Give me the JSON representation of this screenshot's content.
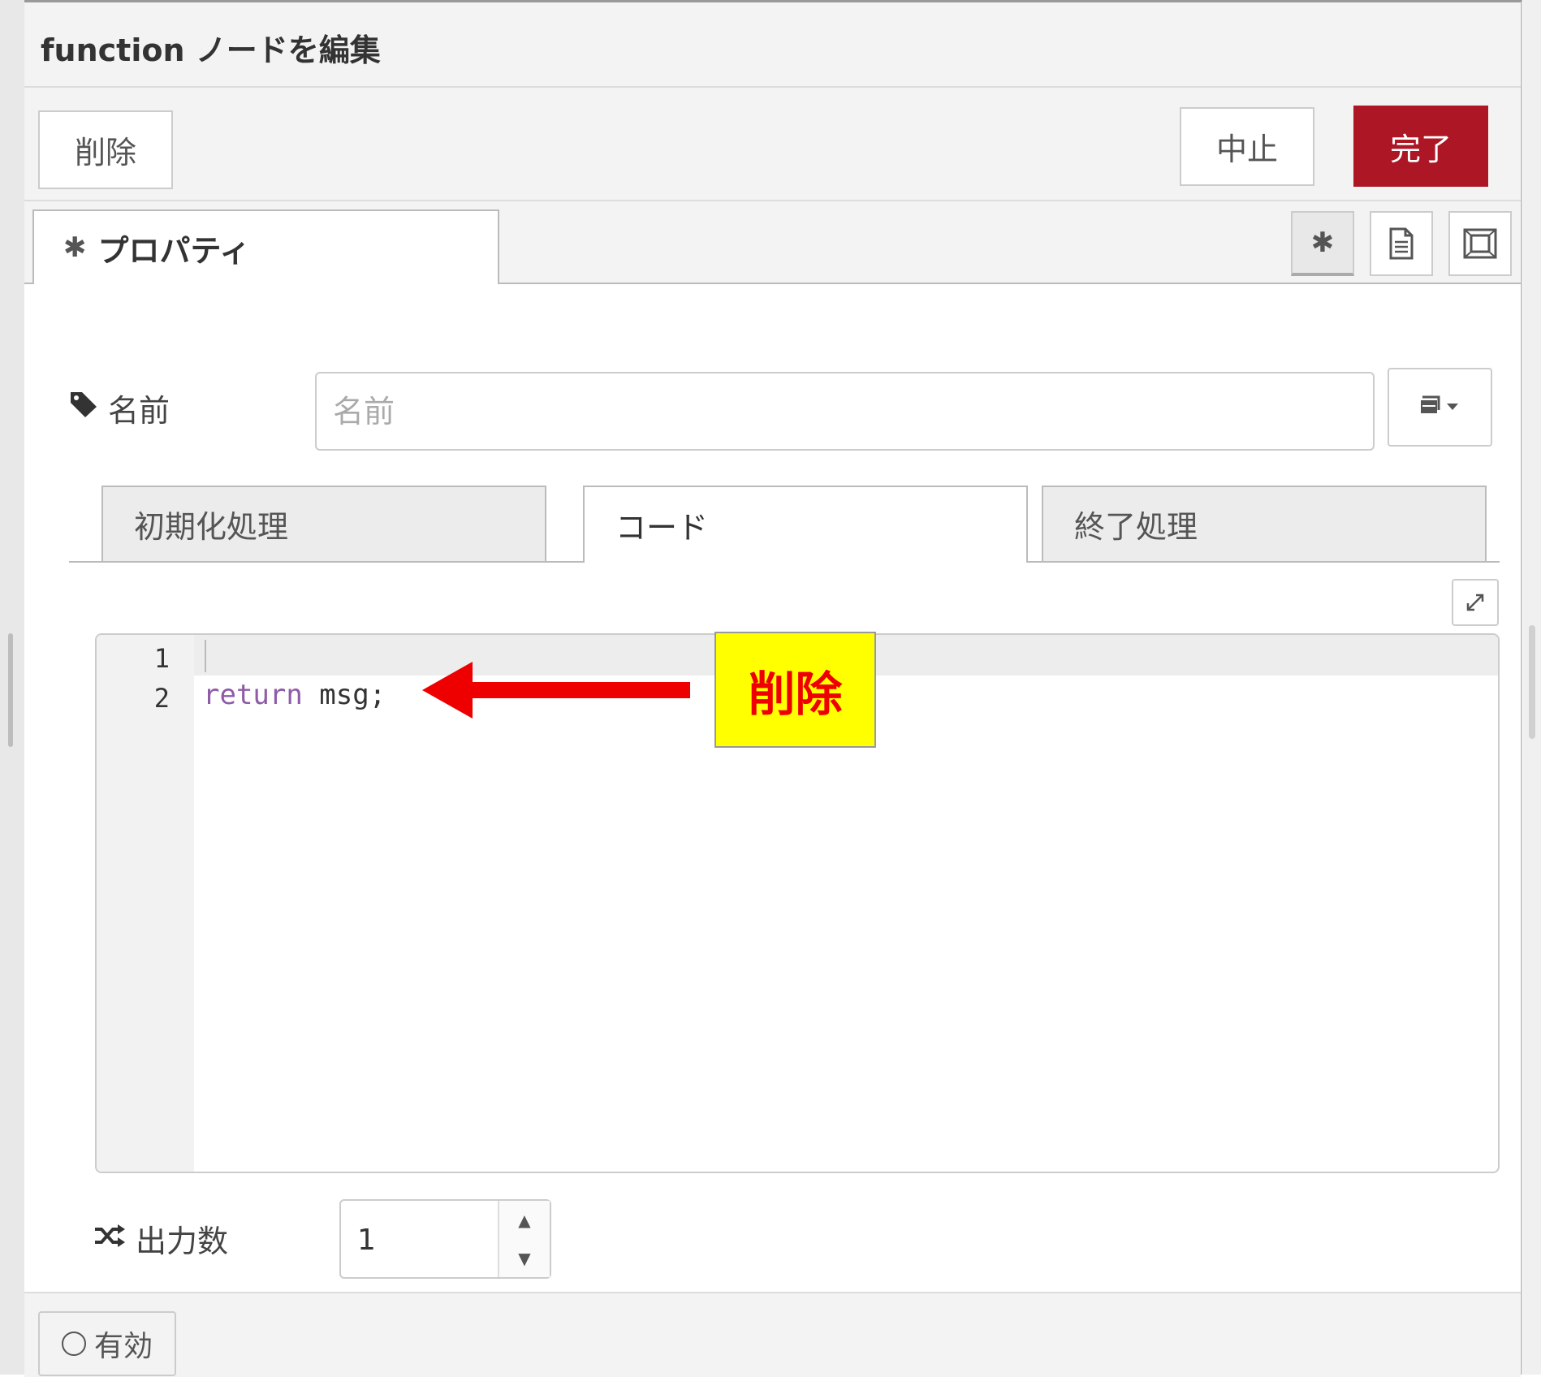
{
  "header": {
    "title": "function ノードを編集"
  },
  "toolbar": {
    "delete_label": "削除",
    "cancel_label": "中止",
    "done_label": "完了"
  },
  "tabs": {
    "properties_label": "プロパティ",
    "icons": [
      "gear-icon",
      "document-icon",
      "frame-icon"
    ]
  },
  "form": {
    "name_label": "名前",
    "name_placeholder": "名前",
    "name_value": "",
    "icon_select": "book-icon",
    "subtabs": [
      "初期化処理",
      "コード",
      "終了処理"
    ],
    "active_subtab": "コード",
    "outputs_label": "出力数",
    "outputs_value": "1"
  },
  "editor": {
    "line_numbers": [
      "1",
      "2"
    ],
    "code_lines": [
      "",
      "return msg;"
    ],
    "keyword": "return",
    "rest": " msg;"
  },
  "annotation": {
    "text": "削除",
    "color": "#ee0000",
    "background": "#ffff00"
  },
  "footer": {
    "enable_label": "有効"
  },
  "colors": {
    "primary": "#ad1625",
    "keyword": "#8f5ba8"
  }
}
